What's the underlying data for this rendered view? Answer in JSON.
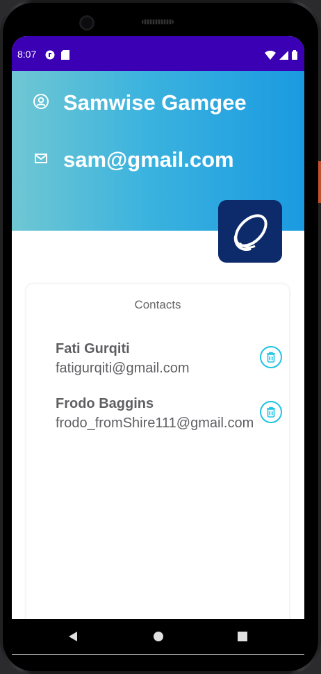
{
  "status_bar": {
    "time": "8:07",
    "icons": [
      "notification-icon",
      "sd-card-icon",
      "wifi-icon",
      "signal-icon",
      "battery-icon"
    ]
  },
  "profile": {
    "name": "Samwise Gamgee",
    "email": "sam@gmail.com",
    "name_icon": "account-circle-icon",
    "email_icon": "mail-icon"
  },
  "contacts": {
    "title": "Contacts",
    "items": [
      {
        "name": "Fati Gurqiti",
        "email": "fatigurqiti@gmail.com"
      },
      {
        "name": "Frodo Baggins",
        "email": "frodo_fromShire111@gmail.com"
      }
    ]
  },
  "navigation": {
    "back": "back-icon",
    "home": "home-icon",
    "recents": "recents-icon"
  },
  "colors": {
    "status_bar": "#3b00b3",
    "gradient_start": "#6fc7d3",
    "gradient_end": "#1a9ae1",
    "logo_bg": "#0d2a6b",
    "delete_accent": "#1ec3e3"
  }
}
